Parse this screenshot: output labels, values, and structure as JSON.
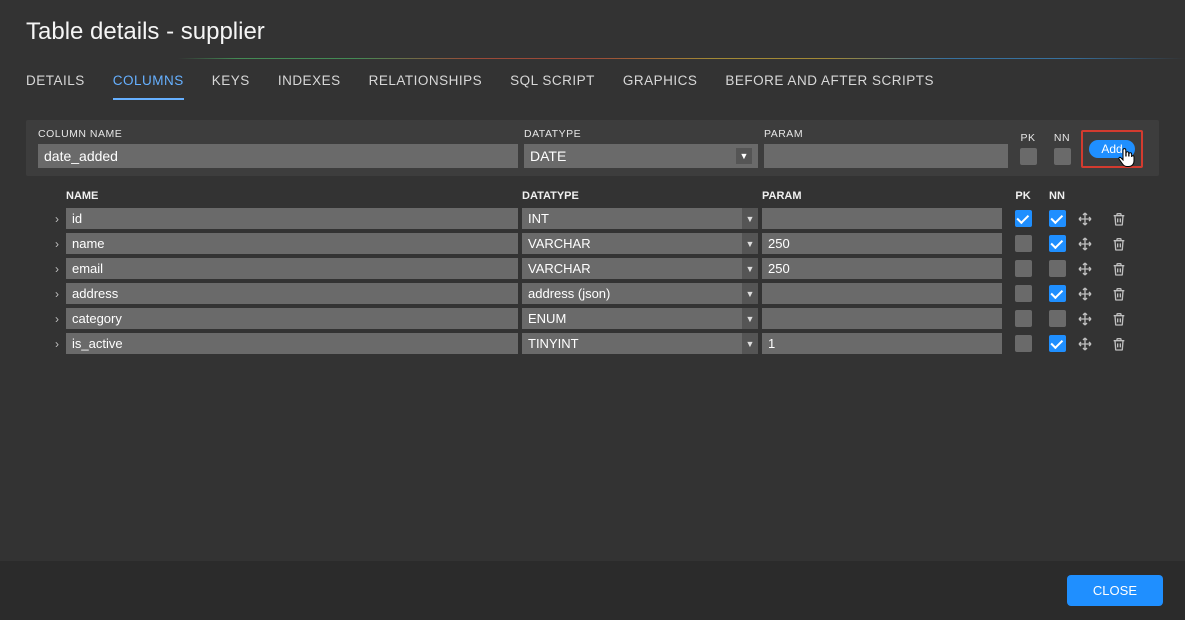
{
  "title": "Table details - supplier",
  "tabs": [
    {
      "label": "DETAILS",
      "active": false
    },
    {
      "label": "COLUMNS",
      "active": true
    },
    {
      "label": "KEYS",
      "active": false
    },
    {
      "label": "INDEXES",
      "active": false
    },
    {
      "label": "RELATIONSHIPS",
      "active": false
    },
    {
      "label": "SQL SCRIPT",
      "active": false
    },
    {
      "label": "GRAPHICS",
      "active": false
    },
    {
      "label": "BEFORE AND AFTER SCRIPTS",
      "active": false
    }
  ],
  "new_col": {
    "headers": {
      "name": "COLUMN NAME",
      "datatype": "DATATYPE",
      "param": "PARAM",
      "pk": "PK",
      "nn": "NN"
    },
    "name": "date_added",
    "datatype": "DATE",
    "param": "",
    "pk": false,
    "nn": false,
    "add_label": "Add"
  },
  "list_headers": {
    "name": "NAME",
    "datatype": "DATATYPE",
    "param": "PARAM",
    "pk": "PK",
    "nn": "NN"
  },
  "columns": [
    {
      "name": "id",
      "datatype": "INT",
      "param": "",
      "pk": true,
      "nn": true
    },
    {
      "name": "name",
      "datatype": "VARCHAR",
      "param": "250",
      "pk": false,
      "nn": true
    },
    {
      "name": "email",
      "datatype": "VARCHAR",
      "param": "250",
      "pk": false,
      "nn": false
    },
    {
      "name": "address",
      "datatype": "address (json)",
      "param": "",
      "pk": false,
      "nn": true
    },
    {
      "name": "category",
      "datatype": "ENUM",
      "param": "",
      "pk": false,
      "nn": false
    },
    {
      "name": "is_active",
      "datatype": "TINYINT",
      "param": "1",
      "pk": false,
      "nn": true
    }
  ],
  "footer": {
    "close": "CLOSE"
  }
}
